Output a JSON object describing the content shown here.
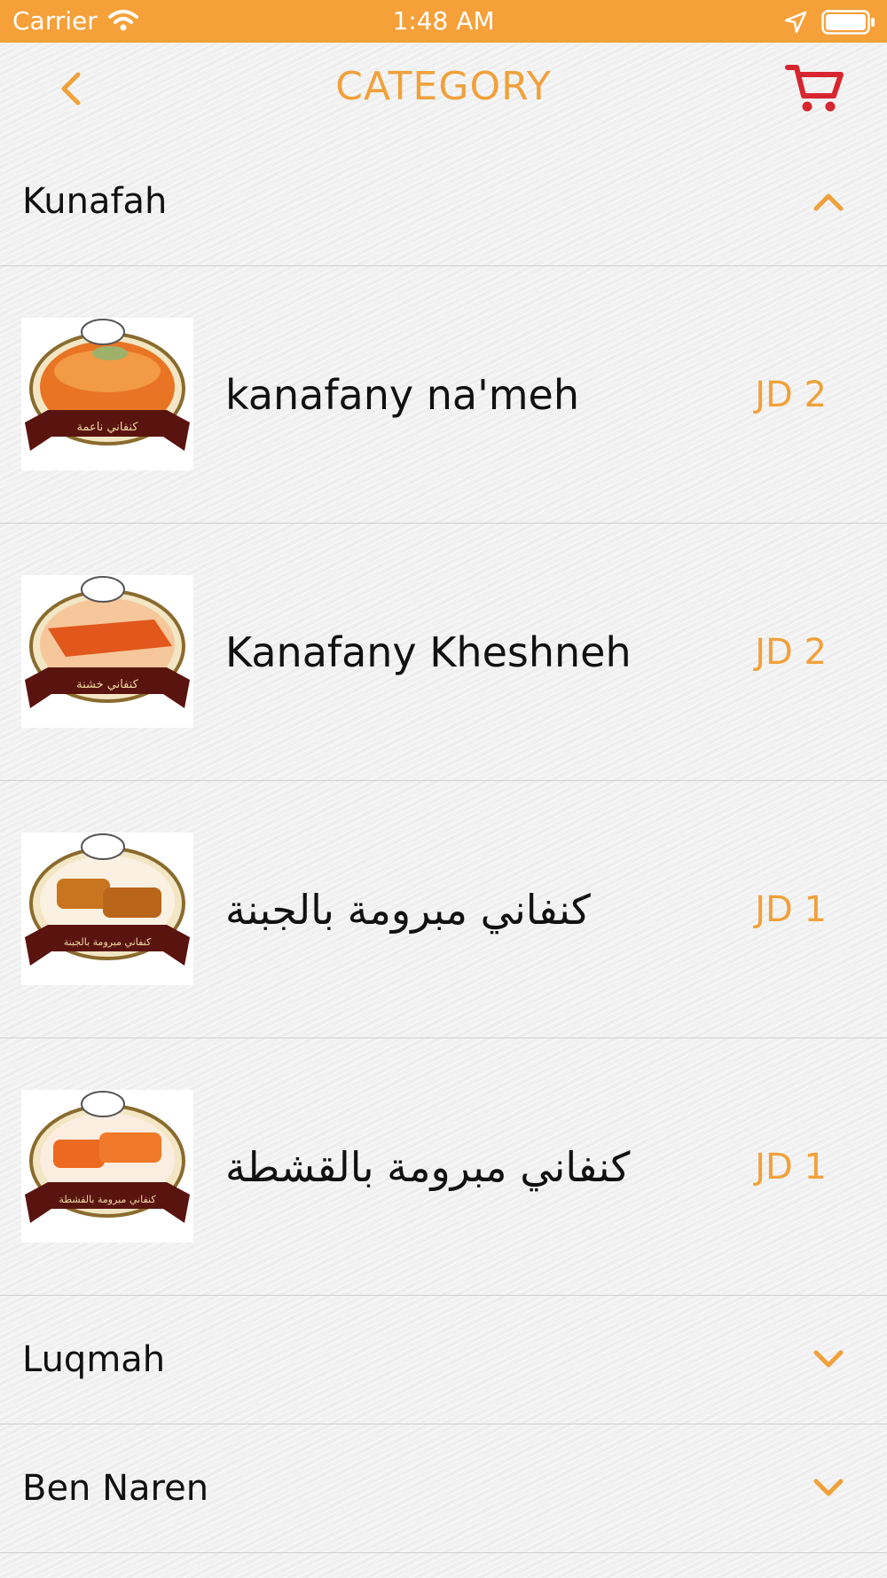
{
  "status_bar": {
    "carrier": "Carrier",
    "time": "1:48 AM",
    "icons": [
      "wifi-icon",
      "location-icon",
      "battery-icon"
    ]
  },
  "nav": {
    "title": "CATEGORY",
    "back_icon": "chevron-left-icon",
    "cart_icon": "cart-icon"
  },
  "colors": {
    "accent": "#f0a13b",
    "status_bar": "#f6a03a",
    "cart": "#d7262f"
  },
  "sections": [
    {
      "label": "Kunafah",
      "expanded": true,
      "items": [
        {
          "name": "kanafany na'meh",
          "price": "JD 2",
          "thumb_caption": "كنفاني ناعمة"
        },
        {
          "name": "Kanafany Kheshneh",
          "price": "JD 2",
          "thumb_caption": "كنفاني خشنة"
        },
        {
          "name": "كنفاني مبرومة بالجبنة",
          "price": "JD 1",
          "thumb_caption": "كنفاني مبرومة بالجبنة"
        },
        {
          "name": "كنفاني مبرومة بالقشطة",
          "price": "JD 1",
          "thumb_caption": "كنفاني مبرومة بالقشطة"
        }
      ]
    },
    {
      "label": "Luqmah",
      "expanded": false
    },
    {
      "label": "Ben Naren",
      "expanded": false
    }
  ]
}
